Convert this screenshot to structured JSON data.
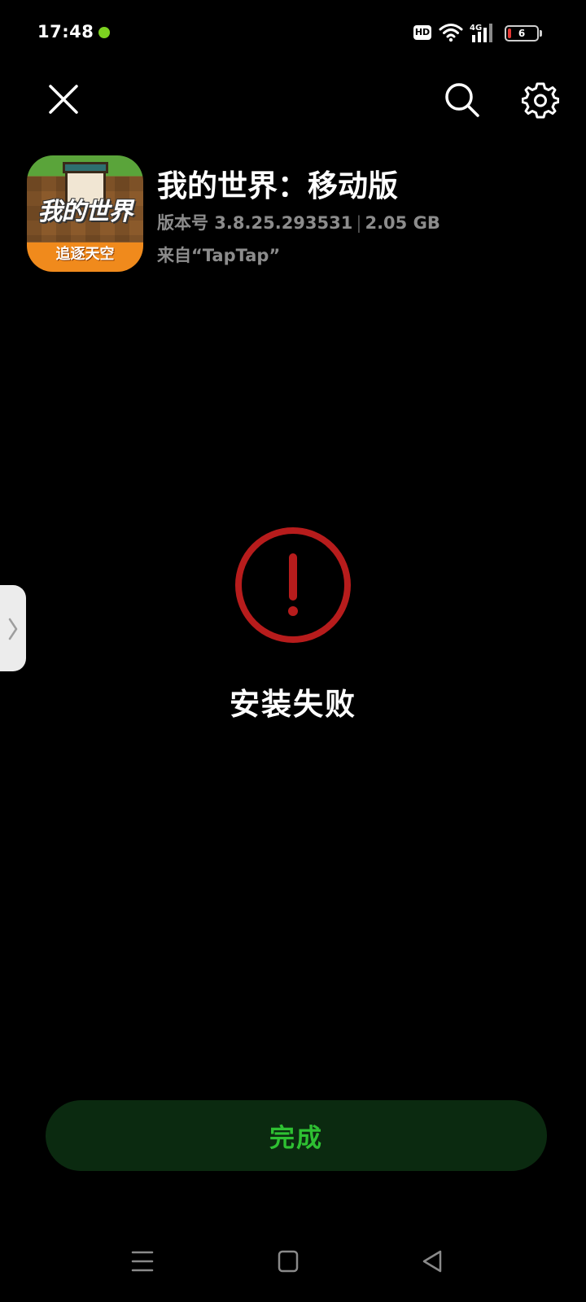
{
  "status_bar": {
    "time": "17:48",
    "hd_label": "HD",
    "network_label": "4G",
    "battery_level": "6",
    "battery_color": "#e53935",
    "dot_color": "#7cd320"
  },
  "header": {
    "close_icon": "close-icon",
    "search_icon": "search-icon",
    "settings_icon": "gear-icon"
  },
  "app": {
    "icon_title": "我的世界",
    "icon_subtitle": "追逐天空",
    "name": "我的世界：移动版",
    "version": "版本号 3.8.25.293531",
    "size": "2.05 GB",
    "source": "来自“TapTap”"
  },
  "result": {
    "icon": "exclamation-circle-icon",
    "icon_color": "#b71c1c",
    "title": "安装失败"
  },
  "actions": {
    "done_label": "完成",
    "done_bg": "#0b2a10",
    "done_text_color": "#2ec032"
  },
  "nav": {
    "menu_icon": "menu-icon",
    "home_icon": "home-icon",
    "back_icon": "back-icon"
  }
}
